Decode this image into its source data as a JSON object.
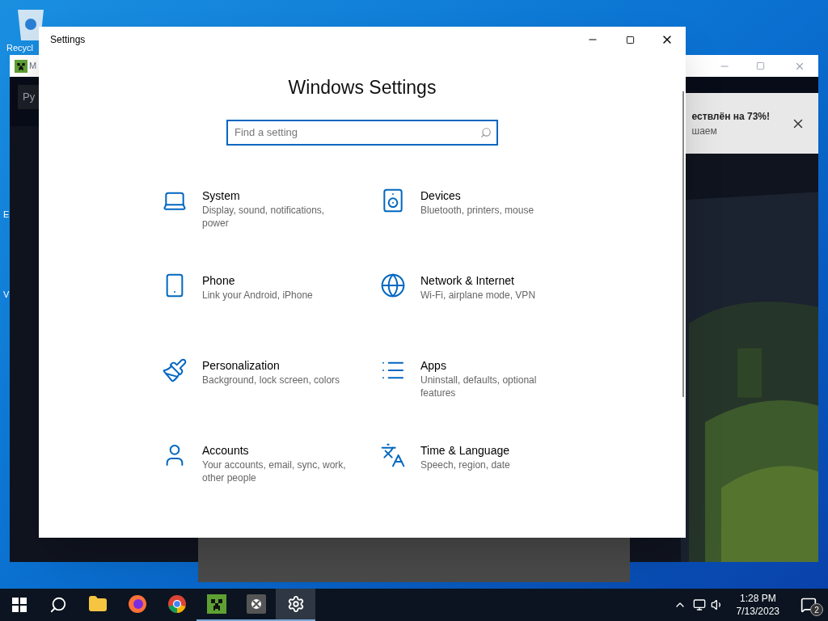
{
  "desktop": {
    "icon_label": "Recycl",
    "edge_letters": [
      "E",
      "V"
    ]
  },
  "background_window": {
    "title": "M",
    "button": "Ру",
    "notification": {
      "title": "ествлён на 73%!",
      "text": "шаем"
    }
  },
  "settings": {
    "title": "Settings",
    "heading": "Windows Settings",
    "search": {
      "placeholder": "Find a setting"
    },
    "items": [
      {
        "kind": "system",
        "title": "System",
        "description": "Display, sound, notifications, power"
      },
      {
        "kind": "devices",
        "title": "Devices",
        "description": "Bluetooth, printers, mouse"
      },
      {
        "kind": "phone",
        "title": "Phone",
        "description": "Link your Android, iPhone"
      },
      {
        "kind": "network",
        "title": "Network & Internet",
        "description": "Wi-Fi, airplane mode, VPN"
      },
      {
        "kind": "personalization",
        "title": "Personalization",
        "description": "Background, lock screen, colors"
      },
      {
        "kind": "apps",
        "title": "Apps",
        "description": "Uninstall, defaults, optional features"
      },
      {
        "kind": "accounts",
        "title": "Accounts",
        "description": "Your accounts, email, sync, work, other people"
      },
      {
        "kind": "time",
        "title": "Time & Language",
        "description": "Speech, region, date"
      }
    ]
  },
  "taskbar": {
    "apps": [
      {
        "kind": "explorer",
        "running": false,
        "selected": false
      },
      {
        "kind": "firefox",
        "running": false,
        "selected": false
      },
      {
        "kind": "chrome",
        "running": false,
        "selected": false
      },
      {
        "kind": "minecraft",
        "running": true,
        "selected": false
      },
      {
        "kind": "xbox",
        "running": true,
        "selected": false
      },
      {
        "kind": "settings",
        "running": true,
        "selected": true
      }
    ],
    "time": "1:28 PM",
    "date": "7/13/2023",
    "notification_count": "2"
  }
}
